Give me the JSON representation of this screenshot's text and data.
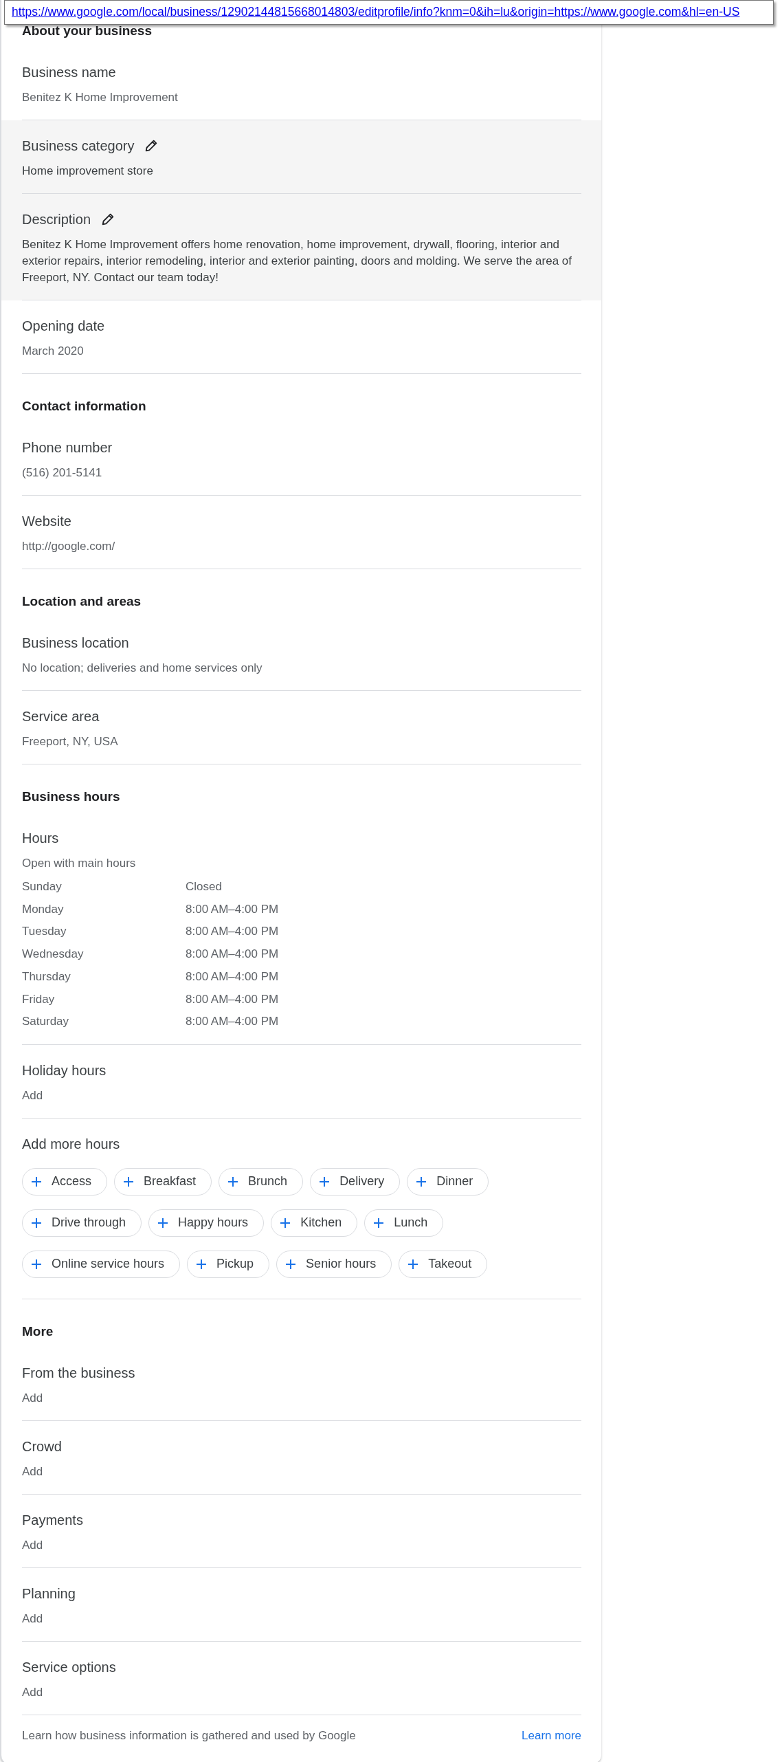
{
  "tooltip": {
    "url": "https://www.google.com/local/business/12902144815668014803/editprofile/info?knm=0&ih=lu&origin=https://www.google.com&hl=en-US"
  },
  "sections": [
    {
      "heading": "About your business",
      "items": [
        {
          "kind": "field",
          "label": "Business name",
          "value": "Benitez K Home Improvement",
          "editable": false,
          "highlighted": false
        },
        {
          "kind": "field",
          "label": "Business category",
          "value": "Home improvement store",
          "editable": true,
          "highlighted": true
        },
        {
          "kind": "field",
          "label": "Description",
          "value": "Benitez K Home Improvement offers home renovation, home improvement, drywall, flooring, interior and exterior repairs, interior remodeling, interior and exterior painting, doors and molding. We serve the area of Freeport, NY. Contact our team today!",
          "editable": true,
          "highlighted": true
        },
        {
          "kind": "field",
          "label": "Opening date",
          "value": "March 2020",
          "editable": false,
          "highlighted": false
        }
      ]
    },
    {
      "heading": "Contact information",
      "items": [
        {
          "kind": "field",
          "label": "Phone number",
          "value": "(516) 201-5141",
          "editable": false,
          "highlighted": false
        },
        {
          "kind": "field",
          "label": "Website",
          "value": "http://google.com/",
          "editable": false,
          "highlighted": false
        }
      ]
    },
    {
      "heading": "Location and areas",
      "items": [
        {
          "kind": "field",
          "label": "Business location",
          "value": "No location; deliveries and home services only",
          "editable": false,
          "highlighted": false
        },
        {
          "kind": "field",
          "label": "Service area",
          "value": "Freeport, NY, USA",
          "editable": false,
          "highlighted": false
        }
      ]
    },
    {
      "heading": "Business hours",
      "items": [
        {
          "kind": "hours",
          "label": "Hours",
          "note": "Open with main hours",
          "rows": [
            {
              "day": "Sunday",
              "time": "Closed"
            },
            {
              "day": "Monday",
              "time": "8:00 AM–4:00 PM"
            },
            {
              "day": "Tuesday",
              "time": "8:00 AM–4:00 PM"
            },
            {
              "day": "Wednesday",
              "time": "8:00 AM–4:00 PM"
            },
            {
              "day": "Thursday",
              "time": "8:00 AM–4:00 PM"
            },
            {
              "day": "Friday",
              "time": "8:00 AM–4:00 PM"
            },
            {
              "day": "Saturday",
              "time": "8:00 AM–4:00 PM"
            }
          ]
        },
        {
          "kind": "field",
          "label": "Holiday hours",
          "value": "Add",
          "editable": false,
          "highlighted": false
        },
        {
          "kind": "chips",
          "label": "Add more hours",
          "chips": [
            "Access",
            "Breakfast",
            "Brunch",
            "Delivery",
            "Dinner",
            "Drive through",
            "Happy hours",
            "Kitchen",
            "Lunch",
            "Online service hours",
            "Pickup",
            "Senior hours",
            "Takeout"
          ]
        }
      ]
    },
    {
      "heading": "More",
      "items": [
        {
          "kind": "field",
          "label": "From the business",
          "value": "Add",
          "editable": false,
          "highlighted": false
        },
        {
          "kind": "field",
          "label": "Crowd",
          "value": "Add",
          "editable": false,
          "highlighted": false
        },
        {
          "kind": "field",
          "label": "Payments",
          "value": "Add",
          "editable": false,
          "highlighted": false
        },
        {
          "kind": "field",
          "label": "Planning",
          "value": "Add",
          "editable": false,
          "highlighted": false
        },
        {
          "kind": "field",
          "label": "Service options",
          "value": "Add",
          "editable": false,
          "highlighted": false
        }
      ]
    }
  ],
  "footer": {
    "text": "Learn how business information is gathered and used by Google",
    "link": "Learn more"
  }
}
